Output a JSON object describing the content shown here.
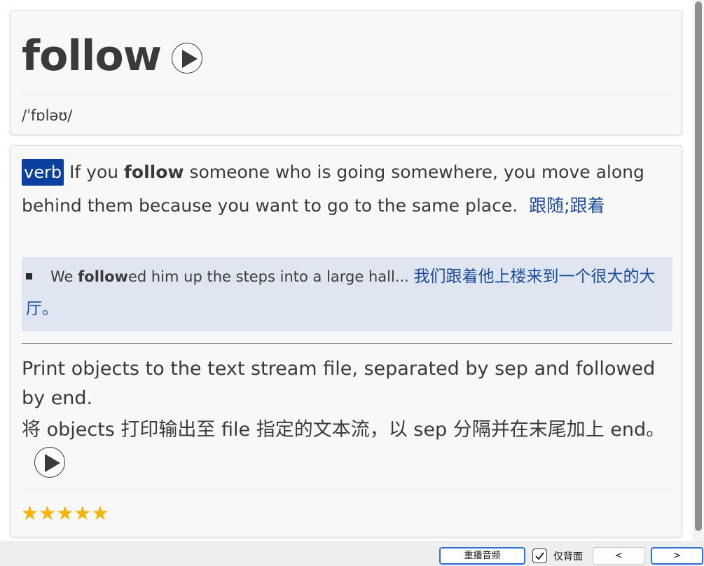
{
  "word": {
    "headword": "follow",
    "phonetic": "/ˈfɒləʊ/"
  },
  "sense": {
    "pos": "verb",
    "def_part1": "If you ",
    "def_bold": "follow",
    "def_part2": " someone who is going somewhere, you move along behind them because you want to go to the same place.",
    "def_zh": "跟随;跟着",
    "example": {
      "pre": "We ",
      "bold": "follow",
      "post": "ed him up the steps into a large hall... ",
      "zh": "我们跟着他上楼来到一个很大的大厅。"
    }
  },
  "extra": {
    "en": "Print objects to the text stream file, separated by sep and followed by end.",
    "zh": "将 objects 打印输出至 file 指定的文本流，以 sep 分隔并在末尾加上 end。"
  },
  "rating": {
    "stars": "★★★★★"
  },
  "toolbar": {
    "replay_label": "重播音频",
    "back_only_label": "仅背面",
    "back_only_checked": true,
    "prev_label": "<",
    "next_label": ">"
  },
  "colors": {
    "accent_badge": "#0b3fa0",
    "zh_text": "#1d4a9a",
    "example_bg": "#dfe5f1",
    "star": "#f5b400"
  },
  "icons": {
    "play": "play-icon",
    "check": "check-icon"
  }
}
